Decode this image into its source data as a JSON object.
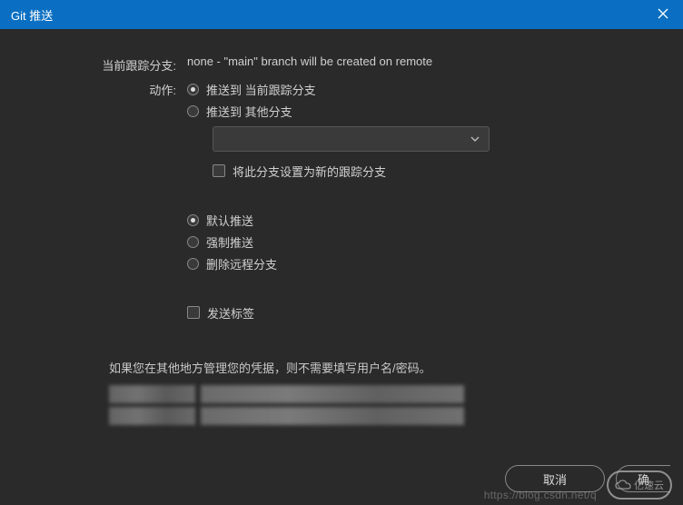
{
  "titlebar": {
    "title": "Git 推送"
  },
  "form": {
    "trackingBranch": {
      "label": "当前跟踪分支:",
      "value": "none - \"main\" branch will be created on remote"
    },
    "action": {
      "label": "动作:",
      "pushCurrent": "推送到 当前跟踪分支",
      "pushOther": "推送到 其他分支",
      "branchSelectValue": "",
      "setTracking": "将此分支设置为新的跟踪分支"
    },
    "pushType": {
      "default": "默认推送",
      "force": "强制推送",
      "delete": "删除远程分支"
    },
    "sendTags": "发送标签",
    "credentialsInfo": "如果您在其他地方管理您的凭据，则不需要填写用户名/密码。"
  },
  "buttons": {
    "cancel": "取消",
    "ok": "确"
  },
  "watermark": {
    "url": "https://blog.csdn.net/q",
    "brand": "亿速云"
  }
}
